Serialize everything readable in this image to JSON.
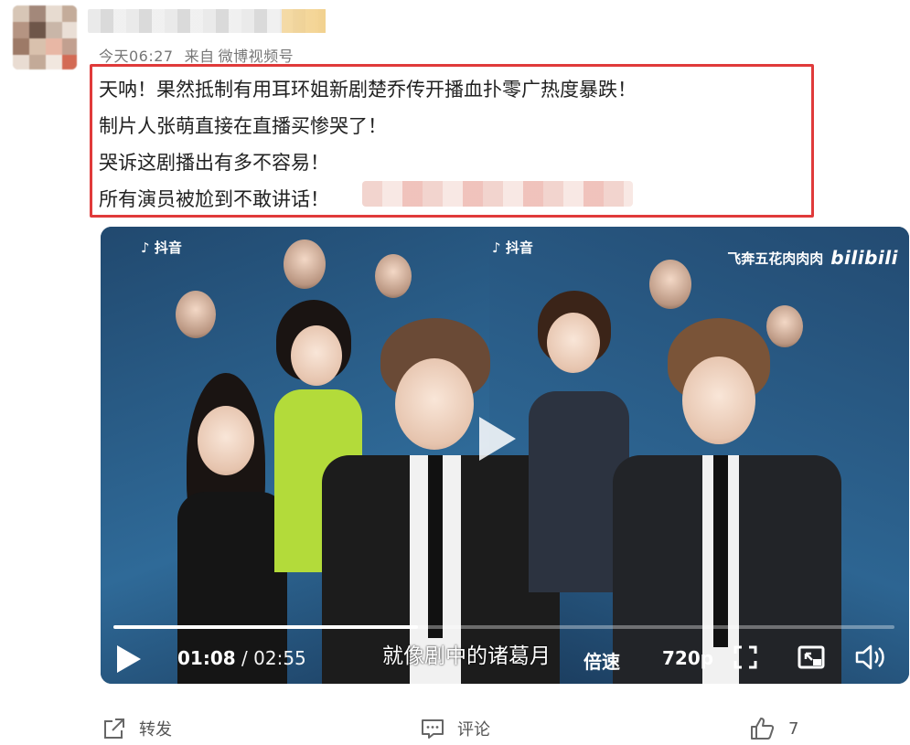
{
  "post": {
    "meta_time": "今天06:27",
    "meta_source_prefix": "来自",
    "meta_source": "微博视频号",
    "lines": [
      "天呐！果然抵制有用耳环姐新剧楚乔传开播血扑零广热度暴跌！",
      "制片人张萌直接在直播买惨哭了！",
      "哭诉这剧播出有多不容易！",
      "所有演员被尬到不敢讲话！"
    ]
  },
  "video": {
    "watermark_left": "抖音",
    "watermark_left_2": "抖音",
    "uploader_mark": "飞奔五花肉肉肉",
    "brand": "bilibili",
    "progress": 0.39,
    "current_time": "01:08",
    "separator": " / ",
    "duration": "02:55",
    "subtitle": "就像剧中的诸葛月",
    "speed_label": "倍速",
    "resolution_label": "720p"
  },
  "footer": {
    "repost_label": "转发",
    "comment_label": "评论",
    "like_count": "7"
  }
}
